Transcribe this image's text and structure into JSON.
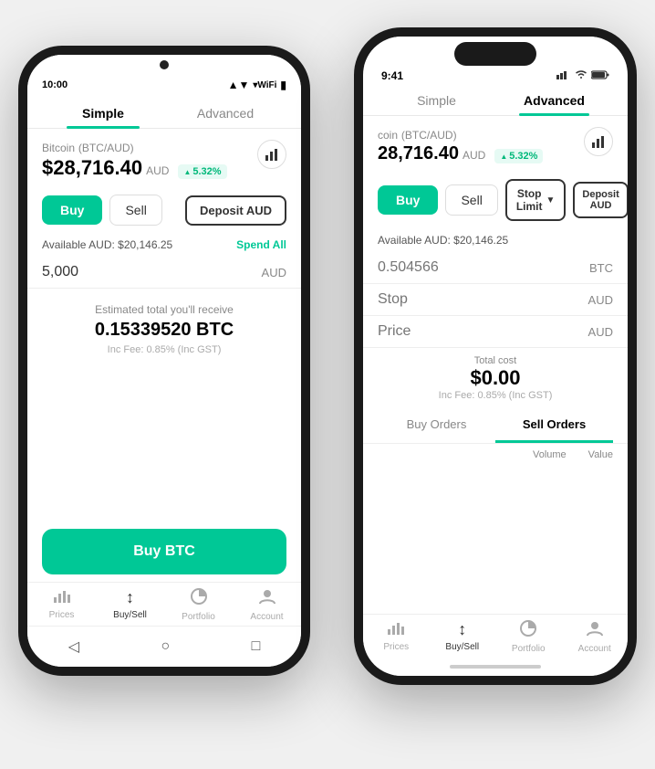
{
  "phone1": {
    "statusBar": {
      "time": "10:00",
      "signal": "▲▼",
      "wifi": "WiFi",
      "battery": "🔋"
    },
    "tabs": {
      "simple": "Simple",
      "advanced": "Advanced",
      "activeTab": "simple"
    },
    "coin": {
      "name": "Bitcoin",
      "pair": "(BTC/AUD)",
      "price": "$28,716.40",
      "currency": "AUD",
      "change": "5.32%"
    },
    "actions": {
      "buy": "Buy",
      "sell": "Sell",
      "deposit": "Deposit AUD"
    },
    "available": {
      "label": "Available AUD: $20,146.25",
      "spendAll": "Spend All"
    },
    "amountInput": {
      "value": "5,000",
      "currency": "AUD"
    },
    "estimate": {
      "label": "Estimated total you'll receive",
      "value": "0.15339520 BTC",
      "fee": "Inc Fee: 0.85% (Inc GST)"
    },
    "buyButton": "Buy BTC",
    "bottomNav": [
      {
        "icon": "📊",
        "label": "Prices",
        "active": false
      },
      {
        "icon": "↕",
        "label": "Buy/Sell",
        "active": true
      },
      {
        "icon": "🥧",
        "label": "Portfolio",
        "active": false
      },
      {
        "icon": "👤",
        "label": "Account",
        "active": false
      }
    ],
    "androidNav": [
      "◁",
      "○",
      "□"
    ]
  },
  "phone2": {
    "statusBar": {
      "time": "9:41",
      "signal": "●●●",
      "wifi": "WiFi",
      "battery": "🔋"
    },
    "tabs": {
      "simple": "Simple",
      "advanced": "Advanced",
      "activeTab": "advanced"
    },
    "coin": {
      "name": "coin",
      "pair": "(BTC/AUD)",
      "price": "28,716.40",
      "currency": "AUD",
      "change": "5.32%"
    },
    "actions": {
      "buy": "Buy",
      "sell": "Sell",
      "stopLimit": "Stop Limit",
      "deposit": "Deposit AUD"
    },
    "available": {
      "label": "Available AUD: $20,146.25"
    },
    "inputs": [
      {
        "placeholder": "0.504566",
        "currency": "BTC"
      },
      {
        "placeholder": "Stop",
        "currency": "AUD"
      },
      {
        "placeholder": "Price",
        "currency": "AUD"
      }
    ],
    "total": {
      "label": "Total cost",
      "value": "$0.00",
      "fee": "Inc Fee: 0.85% (Inc GST)"
    },
    "orders": {
      "buyOrders": "Buy Orders",
      "sellOrders": "Sell Orders",
      "headers": [
        "Volume",
        "Value"
      ]
    },
    "bottomNav": [
      {
        "icon": "📊",
        "label": "Prices",
        "active": false
      },
      {
        "icon": "↕",
        "label": "Buy/Sell",
        "active": true
      },
      {
        "icon": "🥧",
        "label": "Portfolio",
        "active": false
      },
      {
        "icon": "👤",
        "label": "Account",
        "active": false
      }
    ]
  }
}
